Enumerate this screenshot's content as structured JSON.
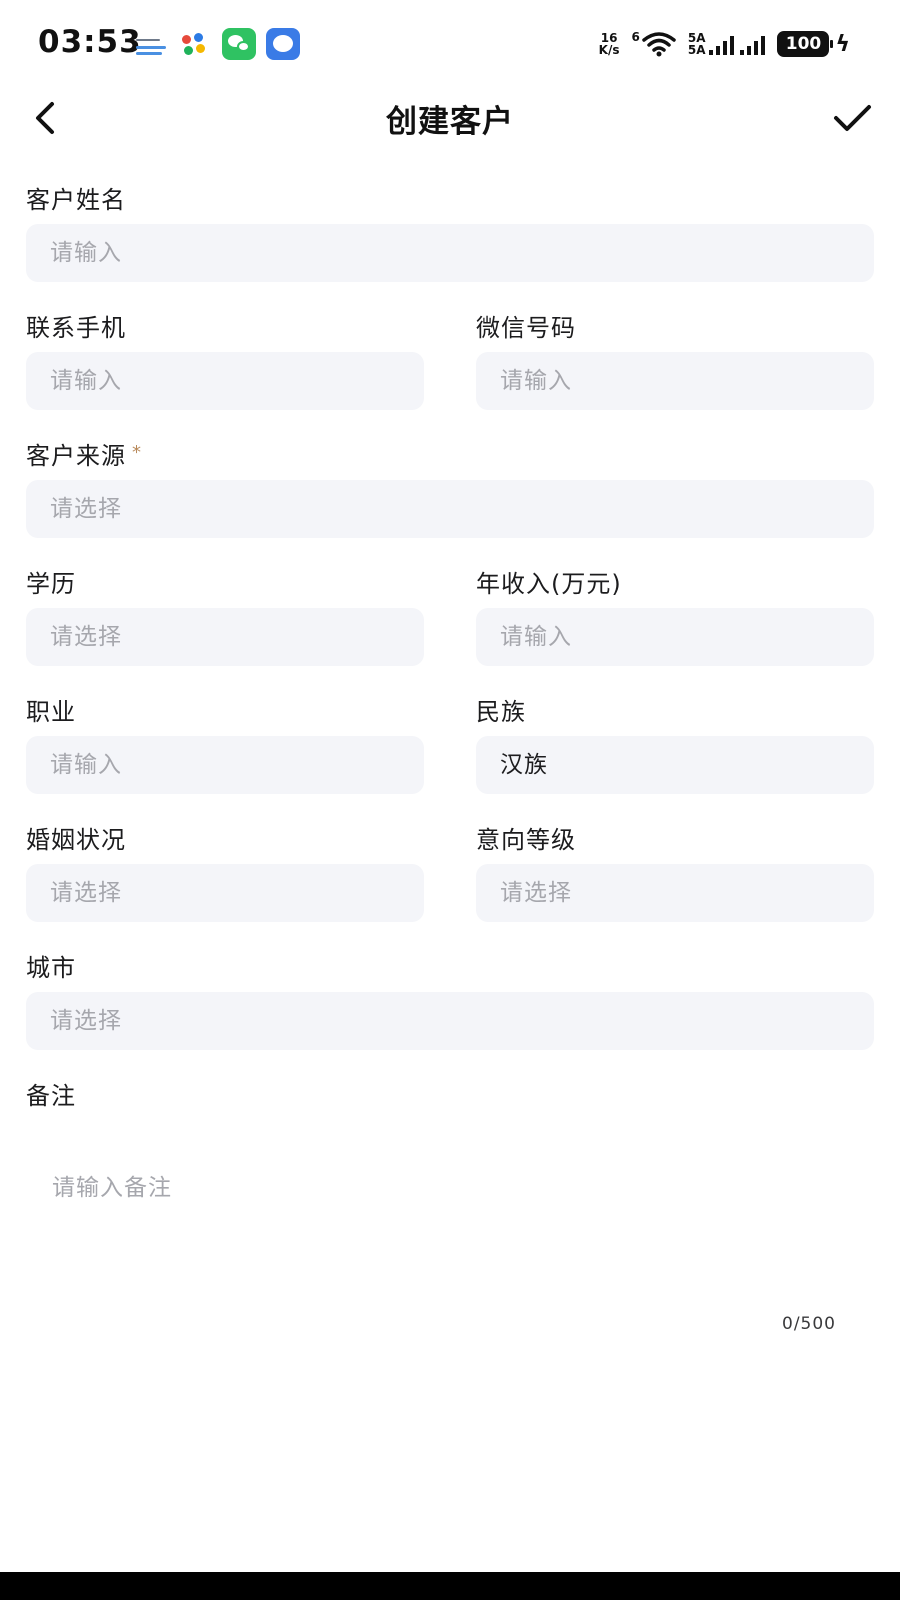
{
  "status_bar": {
    "time": "03:53",
    "net_speed_top": "16",
    "net_speed_bottom": "K/s",
    "wifi_sub": "6",
    "sig1_top": "5A",
    "sig1_bottom": "5A",
    "battery": "100"
  },
  "header": {
    "title": "创建客户"
  },
  "form": {
    "name": {
      "label": "客户姓名",
      "placeholder": "请输入"
    },
    "phone": {
      "label": "联系手机",
      "placeholder": "请输入"
    },
    "wechat": {
      "label": "微信号码",
      "placeholder": "请输入"
    },
    "source": {
      "label": "客户来源",
      "required_mark": "*",
      "placeholder": "请选择"
    },
    "education": {
      "label": "学历",
      "placeholder": "请选择"
    },
    "income": {
      "label": "年收入(万元)",
      "placeholder": "请输入"
    },
    "occupation": {
      "label": "职业",
      "placeholder": "请输入"
    },
    "ethnicity": {
      "label": "民族",
      "value": "汉族"
    },
    "marital": {
      "label": "婚姻状况",
      "placeholder": "请选择"
    },
    "intent": {
      "label": "意向等级",
      "placeholder": "请选择"
    },
    "city": {
      "label": "城市",
      "placeholder": "请选择"
    },
    "remark": {
      "label": "备注",
      "placeholder": "请输入备注",
      "counter": "0/500"
    }
  }
}
